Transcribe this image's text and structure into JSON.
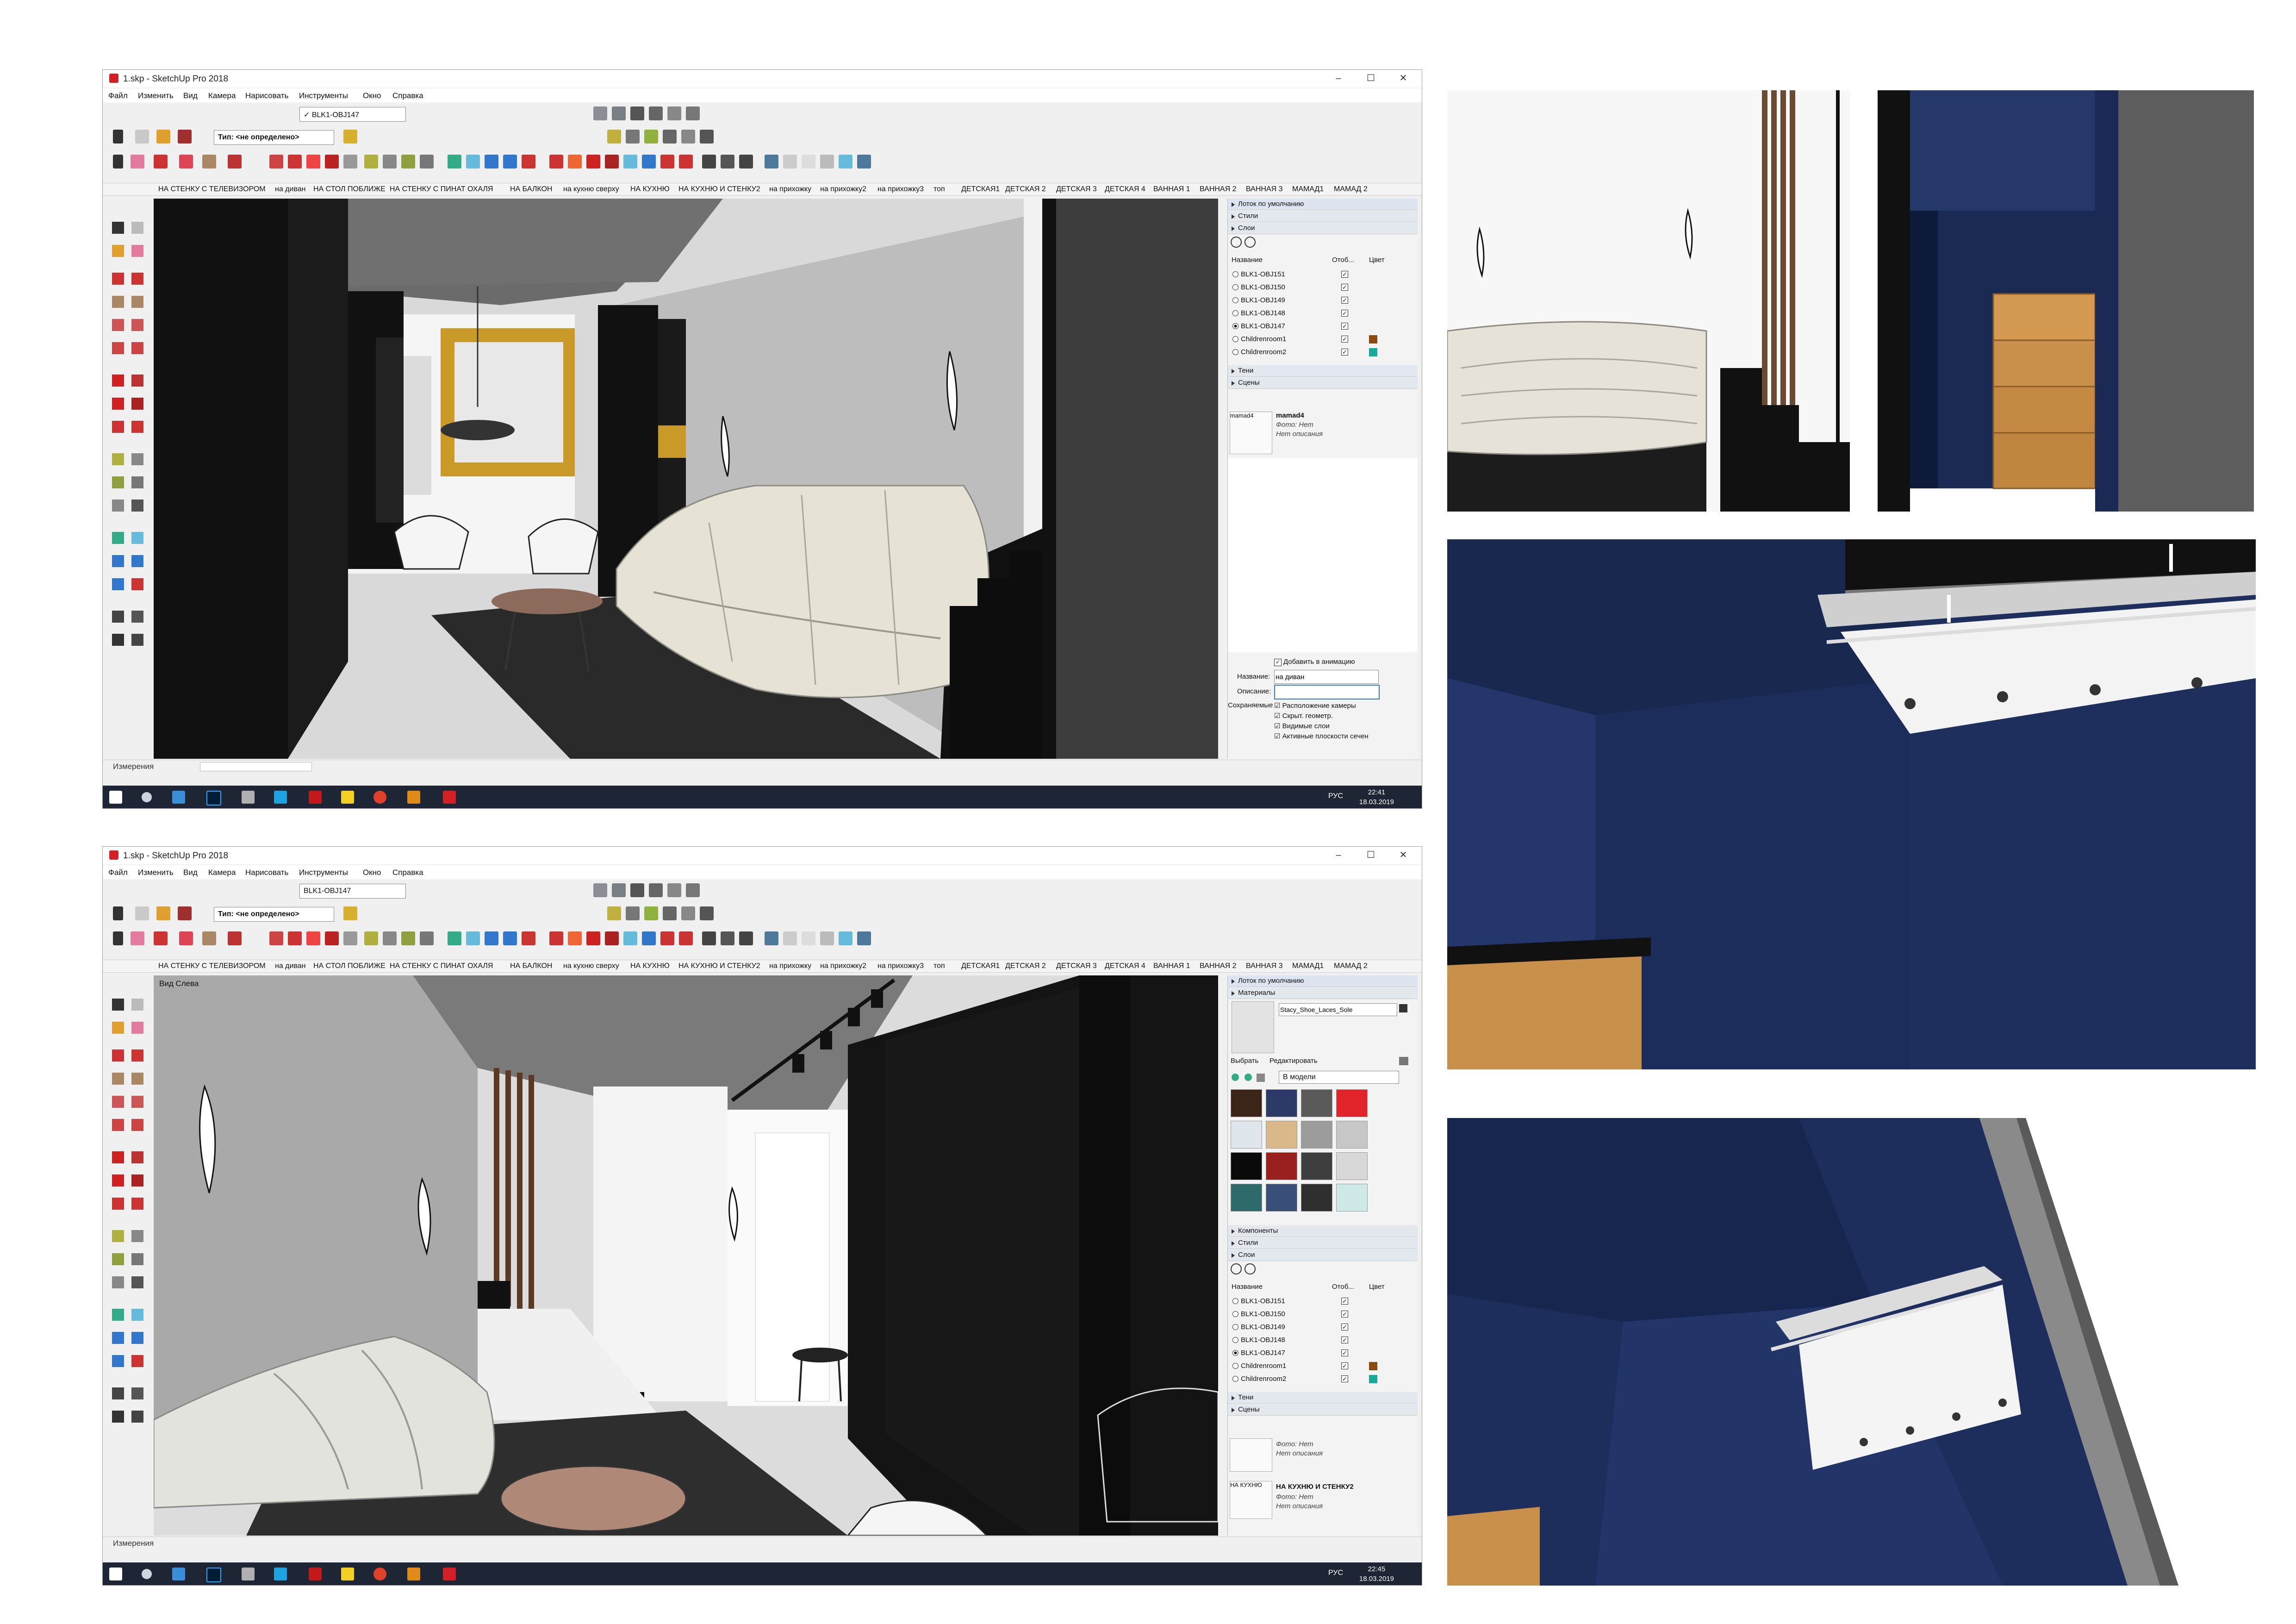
{
  "windows": [
    {
      "title": "1.skp - SketchUp Pro 2018",
      "menu": [
        "Файл",
        "Изменить",
        "Вид",
        "Камера",
        "Нарисовать",
        "Инструменты",
        "Окно",
        "Справка"
      ],
      "layer_dropdown": "✓ BLK1-OBJ147",
      "type_label": "Тип: <не определено>",
      "scenes": [
        "НА СТЕНКУ С ТЕЛЕВИЗОРОМ",
        "на диван",
        "НА СТОЛ ПОБЛИЖЕ",
        "НА СТЕНКУ С ПИНАТ ОХАЛЯ",
        "НА БАЛКОН",
        "на кухню сверху",
        "НА КУХНЮ",
        "НА КУХНЮ И СТЕНКУ2",
        "на прихожку",
        "на прихожку2",
        "на прихожку3",
        "топ",
        "ДЕТСКАЯ1",
        "ДЕТСКАЯ 2",
        "ДЕТСКАЯ 3",
        "ДЕТСКАЯ 4",
        "ВАННАЯ 1",
        "ВАННАЯ 2",
        "ВАННАЯ 3",
        "МАМАД1",
        "МАМАД 2"
      ],
      "status": "Измерения",
      "tray": {
        "title": "Лоток по умолчанию",
        "sections": [
          "Стили",
          "Слои"
        ],
        "layers_header": {
          "name": "Название",
          "visible": "Отоб...",
          "color": "Цвет"
        },
        "layers": [
          {
            "name": "BLK1-OBJ151",
            "active": false,
            "color": ""
          },
          {
            "name": "BLK1-OBJ150",
            "active": false,
            "color": ""
          },
          {
            "name": "BLK1-OBJ149",
            "active": false,
            "color": ""
          },
          {
            "name": "BLK1-OBJ148",
            "active": false,
            "color": ""
          },
          {
            "name": "BLK1-OBJ147",
            "active": true,
            "color": ""
          },
          {
            "name": "Childrenroom1",
            "active": false,
            "color": "#8a4a12"
          },
          {
            "name": "Childrenroom2",
            "active": false,
            "color": "#1aa89a"
          }
        ],
        "shadows_label": "Тени",
        "scenes_label": "Сцены",
        "scene_item": {
          "name": "mamad4",
          "thumb": "mamad4",
          "photo": "Фото: Нет",
          "desc": "Нет описания"
        },
        "add_to_animation": "Добавить в анимацию",
        "name_label": "Название:",
        "name_value": "на диван",
        "desc_label": "Описание:",
        "save_label": "Сохраняемые",
        "props": [
          "Расположение камеры",
          "Скрыт. геометр.",
          "Видимые слои",
          "Активные плоскости сечен"
        ]
      },
      "taskbar": {
        "lang": "РУС",
        "time": "22:41",
        "date": "18.03.2019"
      }
    },
    {
      "title": "1.skp - SketchUp Pro 2018",
      "menu": [
        "Файл",
        "Изменить",
        "Вид",
        "Камера",
        "Нарисовать",
        "Инструменты",
        "Окно",
        "Справка"
      ],
      "layer_dropdown": "BLK1-OBJ147",
      "type_label": "Тип: <не определено>",
      "scenes": [
        "НА СТЕНКУ С ТЕЛЕВИЗОРОМ",
        "на диван",
        "НА СТОЛ ПОБЛИЖЕ",
        "НА СТЕНКУ С ПИНАТ ОХАЛЯ",
        "НА БАЛКОН",
        "на кухню сверху",
        "НА КУХНЮ",
        "НА КУХНЮ И СТЕНКУ2",
        "на прихожку",
        "на прихожку2",
        "на прихожку3",
        "топ",
        "ДЕТСКАЯ1",
        "ДЕТСКАЯ 2",
        "ДЕТСКАЯ 3",
        "ДЕТСКАЯ 4",
        "ВАННАЯ 1",
        "ВАННАЯ 2",
        "ВАННАЯ 3",
        "МАМАД1",
        "МАМАД 2"
      ],
      "viewport_label": "Вид Слева",
      "status": "Измерения",
      "tray": {
        "title": "Лоток по умолчанию",
        "materials_label": "Материалы",
        "material_name": "Stacy_Shoe_Laces_Sole",
        "select_tab": "Выбрать",
        "edit_tab": "Редактировать",
        "in_model": "В модели",
        "swatches": [
          "#3b2418",
          "#2b3a66",
          "#5a5a5a",
          "#e0242a",
          "#dfe6ec",
          "#d9b98a",
          "#9c9c9c",
          "#c7c7c7",
          "#0a0a0a",
          "#9a1f1f",
          "#3e3e3e",
          "#d8d8d8",
          "#2f6a6a",
          "#3a4f78",
          "#2f2f2f",
          "#cfe8e8"
        ],
        "sections": [
          "Компоненты",
          "Стили",
          "Слои"
        ],
        "layers_header": {
          "name": "Название",
          "visible": "Отоб...",
          "color": "Цвет"
        },
        "layers": [
          {
            "name": "BLK1-OBJ151",
            "active": false,
            "color": ""
          },
          {
            "name": "BLK1-OBJ150",
            "active": false,
            "color": ""
          },
          {
            "name": "BLK1-OBJ149",
            "active": false,
            "color": ""
          },
          {
            "name": "BLK1-OBJ148",
            "active": false,
            "color": ""
          },
          {
            "name": "BLK1-OBJ147",
            "active": true,
            "color": ""
          },
          {
            "name": "Childrenroom1",
            "active": false,
            "color": "#8a4a12"
          },
          {
            "name": "Childrenroom2",
            "active": false,
            "color": "#1aa89a"
          }
        ],
        "shadows_label": "Тени",
        "scenes_label": "Сцены",
        "scene_items": [
          {
            "name": "",
            "thumb": "",
            "photo": "Фото: Нет",
            "desc": "Нет описания"
          },
          {
            "name": "НА КУХНЮ И СТЕНКУ2",
            "thumb": "НА КУХНЮ",
            "photo": "Фото: Нет",
            "desc": "Нет описания"
          }
        ]
      },
      "taskbar": {
        "lang": "РУС",
        "time": "22:45",
        "date": "18.03.2019"
      }
    }
  ]
}
